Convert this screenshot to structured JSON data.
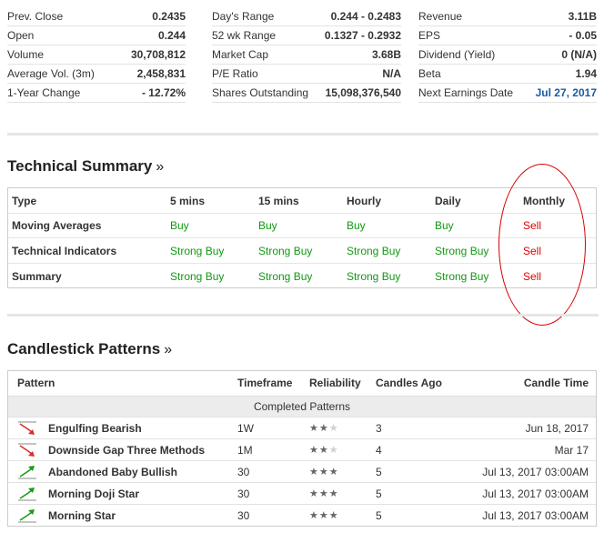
{
  "overview": {
    "col1": [
      {
        "label": "Prev. Close",
        "value": "0.2435"
      },
      {
        "label": "Open",
        "value": "0.244"
      },
      {
        "label": "Volume",
        "value": "30,708,812"
      },
      {
        "label": "Average Vol. (3m)",
        "value": "2,458,831"
      },
      {
        "label": "1-Year Change",
        "value": "- 12.72%"
      }
    ],
    "col2": [
      {
        "label": "Day's Range",
        "value": "0.244 - 0.2483"
      },
      {
        "label": "52 wk Range",
        "value": "0.1327 - 0.2932"
      },
      {
        "label": "Market Cap",
        "value": "3.68B"
      },
      {
        "label": "P/E Ratio",
        "value": "N/A"
      },
      {
        "label": "Shares Outstanding",
        "value": "15,098,376,540"
      }
    ],
    "col3": [
      {
        "label": "Revenue",
        "value": "3.11B"
      },
      {
        "label": "EPS",
        "value": "- 0.05"
      },
      {
        "label": "Dividend (Yield)",
        "value": "0 (N/A)"
      },
      {
        "label": "Beta",
        "value": "1.94"
      },
      {
        "label": "Next Earnings Date",
        "value": "Jul 27, 2017"
      }
    ]
  },
  "technical": {
    "title": "Technical Summary",
    "more": "»",
    "headers": [
      "Type",
      "5 mins",
      "15 mins",
      "Hourly",
      "Daily",
      "Monthly"
    ],
    "rows": [
      {
        "type": "Moving Averages",
        "values": [
          "Buy",
          "Buy",
          "Buy",
          "Buy",
          "Sell"
        ]
      },
      {
        "type": "Technical Indicators",
        "values": [
          "Strong Buy",
          "Strong Buy",
          "Strong Buy",
          "Strong Buy",
          "Sell"
        ]
      },
      {
        "type": "Summary",
        "values": [
          "Strong Buy",
          "Strong Buy",
          "Strong Buy",
          "Strong Buy",
          "Sell"
        ]
      }
    ],
    "colors": {
      "buy": "#119911",
      "sell": "#e00000",
      "annotation": "#d60000"
    }
  },
  "candlestick": {
    "title": "Candlestick Patterns",
    "more": "»",
    "headers": [
      "Pattern",
      "Timeframe",
      "Reliability",
      "Candles Ago",
      "Candle Time"
    ],
    "subheader": "Completed Patterns",
    "rows": [
      {
        "icon": "bearish-arrow-icon",
        "name": "Engulfing Bearish",
        "timeframe": "1W",
        "reliability": 2,
        "candles_ago": "3",
        "time": "Jun 18, 2017"
      },
      {
        "icon": "bearish-arrow-icon",
        "name": "Downside Gap Three Methods",
        "timeframe": "1M",
        "reliability": 2,
        "candles_ago": "4",
        "time": "Mar 17"
      },
      {
        "icon": "bullish-arrow-icon",
        "name": "Abandoned Baby Bullish",
        "timeframe": "30",
        "reliability": 3,
        "candles_ago": "5",
        "time": "Jul 13, 2017 03:00AM"
      },
      {
        "icon": "bullish-arrow-icon",
        "name": "Morning Doji Star",
        "timeframe": "30",
        "reliability": 3,
        "candles_ago": "5",
        "time": "Jul 13, 2017 03:00AM"
      },
      {
        "icon": "bullish-arrow-icon",
        "name": "Morning Star",
        "timeframe": "30",
        "reliability": 3,
        "candles_ago": "5",
        "time": "Jul 13, 2017 03:00AM"
      }
    ],
    "colors": {
      "bearish": "#d9302a",
      "bullish": "#1a9a1a"
    }
  }
}
